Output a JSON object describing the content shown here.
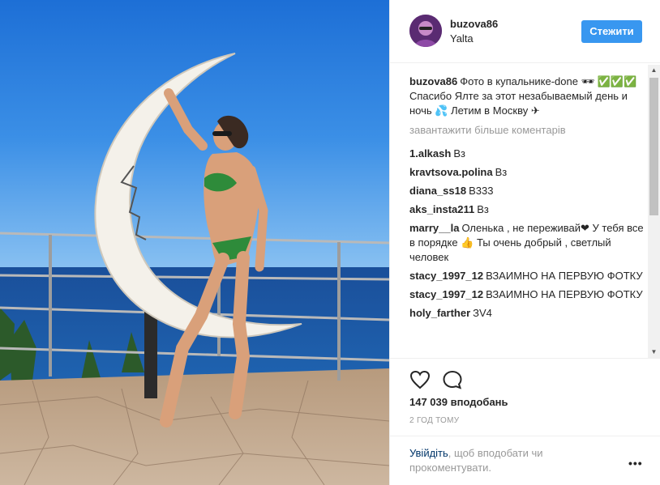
{
  "header": {
    "username": "buzova86",
    "location": "Yalta",
    "follow_label": "Стежити"
  },
  "caption": {
    "username": "buzova86",
    "text": "Фото в купальнике-done 🕶 ✅✅✅ Спасибо Ялте за этот незабываемый день и ночь 💦 Летим в Москву ✈"
  },
  "load_more": "завантажити більше коментарів",
  "comments": [
    {
      "user": "1.alkash",
      "text": "Вз"
    },
    {
      "user": "kravtsova.polina",
      "text": "Вз"
    },
    {
      "user": "diana_ss18",
      "text": "B333"
    },
    {
      "user": "aks_insta211",
      "text": "Вз"
    },
    {
      "user": "marry__la",
      "text": "Оленька , не переживай❤ У тебя все в порядке 👍 Ты очень добрый , светлый человек"
    },
    {
      "user": "stacy_1997_12",
      "text": "ВЗАИМНО НА ПЕРВУЮ ФОТКУ"
    },
    {
      "user": "stacy_1997_12",
      "text": "ВЗАИМНО НА ПЕРВУЮ ФОТКУ"
    },
    {
      "user": "holy_farther",
      "text": "ЗV4"
    }
  ],
  "likes": "147 039 вподобань",
  "time": "2 ГОД ТОМУ",
  "login": {
    "link": "Увійдіть",
    "text": ", щоб вподобати чи прокоментувати."
  },
  "more_label": "•••",
  "icons": {
    "like": "heart-icon",
    "comment": "comment-bubble-icon",
    "more": "more-options-icon",
    "scroll_up": "scroll-up-arrow-icon",
    "scroll_down": "scroll-down-arrow-icon"
  },
  "colors": {
    "accent": "#3897f0",
    "link": "#003569",
    "muted": "#999999"
  }
}
